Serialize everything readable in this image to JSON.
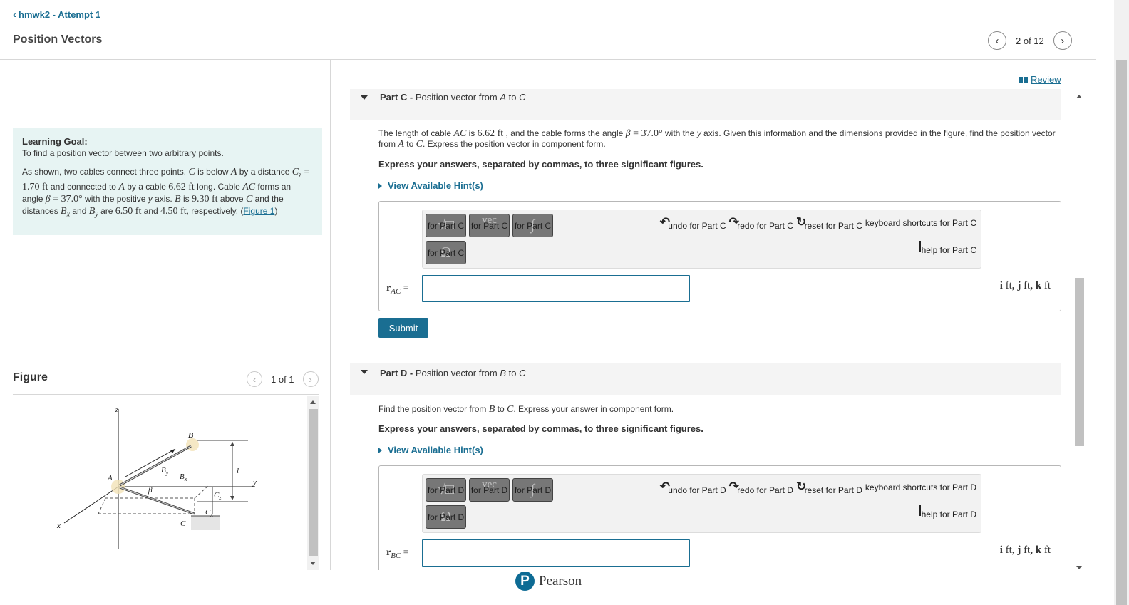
{
  "header": {
    "back_label": "hmwk2 - Attempt 1",
    "title": "Position Vectors",
    "nav_count": "2 of 12"
  },
  "learning_goal": {
    "label": "Learning Goal:",
    "goal": "To find a position vector between two arbitrary points.",
    "text": {
      "t1": "As shown, two cables connect three points. ",
      "C": "C",
      "t2": " is below ",
      "A": "A",
      "t3": " by a distance ",
      "Cz_sym": "C",
      "Cz_sub": "z",
      "eq": " = ",
      "Cz_val": "1.70 ft",
      "t4": " and connected to ",
      "t5": " by a cable ",
      "cable_val": "6.62 ft",
      "t6": " long. Cable ",
      "AC": "AC",
      "t7": " forms an angle ",
      "beta": "β",
      "beta_val": "37.0°",
      "t8": " with the positive ",
      "y": "y",
      "t9": " axis. ",
      "B": "B",
      "t10": " is ",
      "B_val": "9.30 ft",
      "t11": " above ",
      "t12": " and the distances ",
      "Bx_sym": "B",
      "Bx_sub": "x",
      "and": " and ",
      "By_sym": "B",
      "By_sub": "y",
      "t13": " are ",
      "Bx_val": "6.50 ft",
      "By_val": "4.50 ft",
      "t14": ", respectively. (",
      "figure_link": "Figure 1",
      "t15": ")"
    }
  },
  "figure": {
    "heading": "Figure",
    "count": "1 of 1",
    "labels": {
      "z": "z",
      "x": "x",
      "y": "y",
      "A": "A",
      "B": "B",
      "C": "C",
      "By": "B",
      "By_sub": "y",
      "Bx": "B",
      "Bx_sub": "x",
      "beta": "β",
      "Cz": "C",
      "Cz_sub": "z",
      "Cx": "C",
      "Cx_sub": "x",
      "l": "l"
    }
  },
  "review_label": "Review",
  "part_c": {
    "part_label": "Part C - ",
    "title_pre": "Position vector from ",
    "from": "A",
    "to_word": " to ",
    "to": "C",
    "q": {
      "t1": "The length of cable ",
      "AC": "AC",
      "t2": " is ",
      "len": "6.62 ft",
      "t3": " , and the cable forms the angle ",
      "beta": "β",
      "eq": " = ",
      "beta_val": "37.0°",
      "t4": " with the ",
      "y": "y",
      "t5": " axis. Given this information and the dimensions provided in the figure, find the position vector from ",
      "A": "A",
      "to": " to ",
      "C": "C",
      "t6": ". Express the position vector in component form."
    },
    "express": "Express your answers, separated by commas, to three significant figures.",
    "hint": "View Available Hint(s)",
    "toolbar": {
      "btn1": "for Part C",
      "btn2": "for Part C",
      "btn3": "for Part C",
      "btn4": "for Part C",
      "undo": "undo for Part C",
      "redo": "redo for Part C",
      "reset": "reset for Part C",
      "keyboard": "keyboard shortcuts for Part C",
      "help": "help for Part C"
    },
    "answer_label_vec": "r",
    "answer_label_sub": "AC",
    "answer_value": "",
    "units": "i ft, j ft, k ft",
    "submit": "Submit"
  },
  "part_d": {
    "part_label": "Part D - ",
    "title_pre": "Position vector from ",
    "from": "B",
    "to_word": " to ",
    "to": "C",
    "q": {
      "t1": "Find the position vector from ",
      "B": "B",
      "to": " to ",
      "C": "C",
      "t2": ". Express your answer in component form."
    },
    "express": "Express your answers, separated by commas, to three significant figures.",
    "hint": "View Available Hint(s)",
    "toolbar": {
      "btn1": "for Part D",
      "btn2": "for Part D",
      "btn3": "for Part D",
      "btn4": "for Part D",
      "undo": "undo for Part D",
      "redo": "redo for Part D",
      "reset": "reset for Part D",
      "keyboard": "keyboard shortcuts for Part D",
      "help": "help for Part D"
    },
    "answer_label_vec": "r",
    "answer_label_sub": "BC",
    "answer_value": "",
    "units": "i ft, j ft, k ft"
  },
  "footer": {
    "brand": "Pearson",
    "logo_letter": "P"
  },
  "colors": {
    "link": "#1a6e92",
    "goal_bg": "#e7f4f3",
    "part_bg": "#f4f4f4",
    "button": "#1a6e92"
  },
  "icons": [
    "chevron-left-icon",
    "chevron-right-icon",
    "book-icon",
    "triangle-down-icon",
    "triangle-right-icon",
    "undo-icon",
    "redo-icon",
    "reset-icon",
    "keyboard-icon",
    "help-icon"
  ]
}
